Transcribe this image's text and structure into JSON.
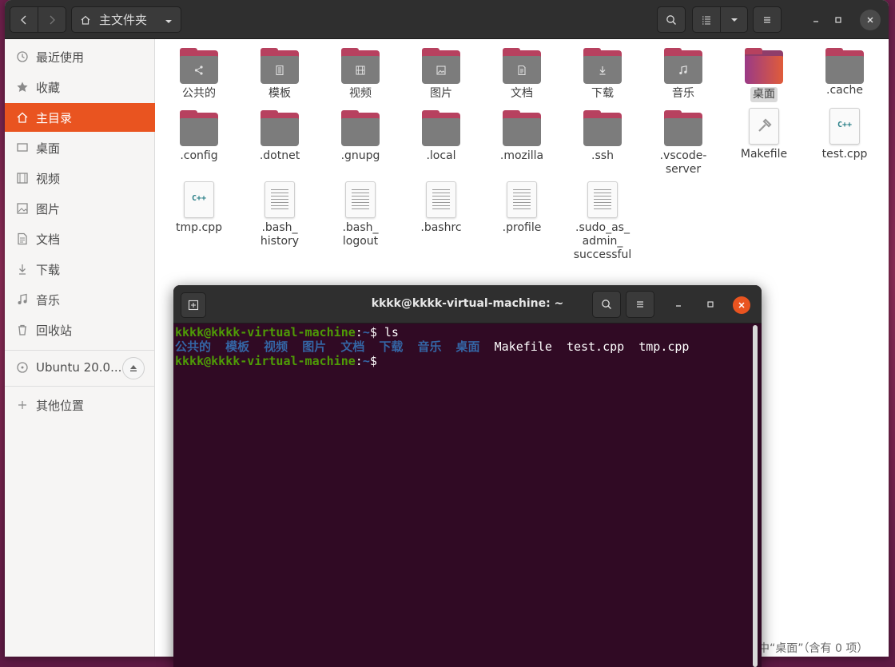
{
  "file_manager": {
    "header": {
      "path_label": "主文件夹"
    },
    "sidebar": {
      "items": [
        {
          "label": "最近使用",
          "icon": "clock-icon"
        },
        {
          "label": "收藏",
          "icon": "star-icon"
        },
        {
          "label": "主目录",
          "icon": "home-icon",
          "active": true
        },
        {
          "label": "桌面",
          "icon": "desktop-icon"
        },
        {
          "label": "视频",
          "icon": "video-icon"
        },
        {
          "label": "图片",
          "icon": "picture-icon"
        },
        {
          "label": "文档",
          "icon": "document-icon"
        },
        {
          "label": "下载",
          "icon": "download-icon"
        },
        {
          "label": "音乐",
          "icon": "music-icon"
        },
        {
          "label": "回收站",
          "icon": "trash-icon"
        }
      ],
      "device": {
        "label": "Ubuntu 20.0...",
        "icon": "disc-icon"
      },
      "other": {
        "label": "其他位置",
        "icon": "plus-icon"
      }
    },
    "files": [
      {
        "name": "公共的",
        "kind": "folder",
        "emblem": "share-icon"
      },
      {
        "name": "模板",
        "kind": "folder",
        "emblem": "template-icon"
      },
      {
        "name": "视频",
        "kind": "folder",
        "emblem": "film-icon"
      },
      {
        "name": "图片",
        "kind": "folder",
        "emblem": "image-icon"
      },
      {
        "name": "文档",
        "kind": "folder",
        "emblem": "doc-icon"
      },
      {
        "name": "下载",
        "kind": "folder",
        "emblem": "download-icon"
      },
      {
        "name": "音乐",
        "kind": "folder",
        "emblem": "music-icon"
      },
      {
        "name": "桌面",
        "kind": "desktop-folder",
        "selected": true
      },
      {
        "name": ".cache",
        "kind": "folder"
      },
      {
        "name": ".config",
        "kind": "folder"
      },
      {
        "name": ".dotnet",
        "kind": "folder"
      },
      {
        "name": ".gnupg",
        "kind": "folder"
      },
      {
        "name": ".local",
        "kind": "folder"
      },
      {
        "name": ".mozilla",
        "kind": "folder"
      },
      {
        "name": ".ssh",
        "kind": "folder"
      },
      {
        "name": ".vscode-\nserver",
        "kind": "folder"
      },
      {
        "name": "Makefile",
        "kind": "makefile"
      },
      {
        "name": "test.cpp",
        "kind": "cpp",
        "badge": "C++"
      },
      {
        "name": "tmp.cpp",
        "kind": "cpp",
        "badge": "C++"
      },
      {
        "name": ".bash_\nhistory",
        "kind": "text"
      },
      {
        "name": ".bash_\nlogout",
        "kind": "text"
      },
      {
        "name": ".bashrc",
        "kind": "text"
      },
      {
        "name": ".profile",
        "kind": "text"
      },
      {
        "name": ".sudo_as_\nadmin_\nsuccessful",
        "kind": "text"
      }
    ],
    "status_fragment": "中“桌面”（含有 0 项）"
  },
  "terminal": {
    "title": "kkkk@kkkk-virtual-machine: ~",
    "prompt_user": "kkkk@kkkk-virtual-machine",
    "prompt_colon": ":",
    "prompt_path": "~",
    "prompt_symbol": "$",
    "command": " ls",
    "ls_dirs": [
      "公共的",
      "模板",
      "视频",
      "图片",
      "文档",
      "下载",
      "音乐",
      "桌面"
    ],
    "ls_files": [
      "Makefile",
      "test.cpp",
      "tmp.cpp"
    ],
    "colors": {
      "user": "#4e9a06",
      "dir": "#3465a4",
      "bg": "#300a24"
    }
  }
}
